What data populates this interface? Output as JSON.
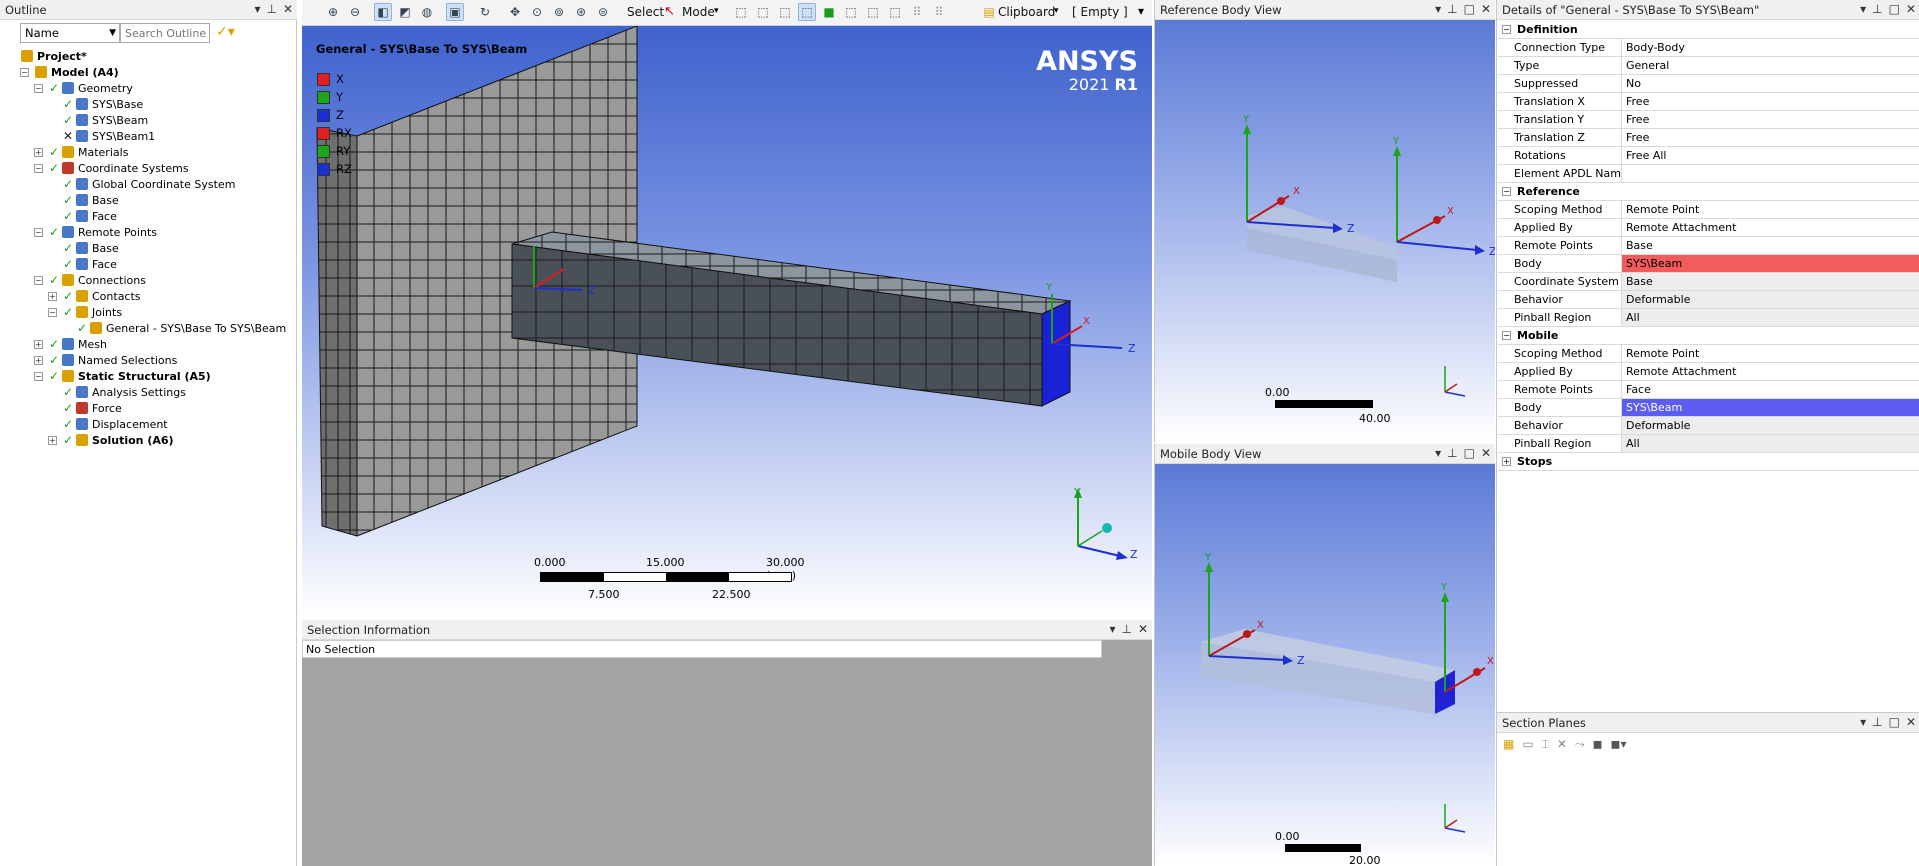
{
  "outline": {
    "title": "Outline",
    "filter_label": "Name",
    "search_placeholder": "Search Outline",
    "items": [
      {
        "label": "Project*",
        "level": 0
      },
      {
        "label": "Model (A4)",
        "level": 1
      },
      {
        "label": "Geometry",
        "level": 2
      },
      {
        "label": "SYS\\Base",
        "level": 3
      },
      {
        "label": "SYS\\Beam",
        "level": 3
      },
      {
        "label": "SYS\\Beam1",
        "level": 3
      },
      {
        "label": "Materials",
        "level": 2
      },
      {
        "label": "Coordinate Systems",
        "level": 2
      },
      {
        "label": "Global Coordinate System",
        "level": 3
      },
      {
        "label": "Base",
        "level": 3
      },
      {
        "label": "Face",
        "level": 3
      },
      {
        "label": "Remote Points",
        "level": 2
      },
      {
        "label": "Base",
        "level": 3
      },
      {
        "label": "Face",
        "level": 3
      },
      {
        "label": "Connections",
        "level": 2
      },
      {
        "label": "Contacts",
        "level": 3
      },
      {
        "label": "Joints",
        "level": 3
      },
      {
        "label": "General - SYS\\Base To SYS\\Beam",
        "level": 4
      },
      {
        "label": "Mesh",
        "level": 2
      },
      {
        "label": "Named Selections",
        "level": 2
      },
      {
        "label": "Static Structural (A5)",
        "level": 2
      },
      {
        "label": "Analysis Settings",
        "level": 3
      },
      {
        "label": "Force",
        "level": 3
      },
      {
        "label": "Displacement",
        "level": 3
      },
      {
        "label": "Solution (A6)",
        "level": 3
      }
    ]
  },
  "toolbar": {
    "select_label": "Select",
    "mode_label": "Mode",
    "clipboard_label": "Clipboard",
    "empty_label": "[ Empty ]"
  },
  "viewport": {
    "title": "General - SYS\\Base To SYS\\Beam",
    "brand": "ANSYS",
    "version_year": "2021",
    "version_rel": "R1",
    "legend": [
      {
        "label": "X",
        "color": "#e02020"
      },
      {
        "label": "Y",
        "color": "#1aa51a"
      },
      {
        "label": "Z",
        "color": "#1c2fd0"
      },
      {
        "label": "RX",
        "color": "#e02020"
      },
      {
        "label": "RY",
        "color": "#1aa51a"
      },
      {
        "label": "RZ",
        "color": "#1c2fd0"
      }
    ],
    "scale_top": [
      "0.000",
      "15.000",
      "30.000 (mm)"
    ],
    "scale_bottom": [
      "7.500",
      "22.500"
    ],
    "axis_y": "Y",
    "axis_z": "Z",
    "axis_x": "X"
  },
  "selection_info": {
    "title": "Selection Information",
    "text": "No Selection"
  },
  "reference_view": {
    "title": "Reference Body View",
    "scale_min": "0.00",
    "scale_max": "40.00"
  },
  "mobile_view": {
    "title": "Mobile Body View",
    "scale_min": "0.00",
    "scale_max": "20.00"
  },
  "details": {
    "title": "Details of \"General - SYS\\Base To SYS\\Beam\"",
    "sections": [
      {
        "name": "Definition",
        "rows": [
          {
            "k": "Connection Type",
            "v": "Body-Body"
          },
          {
            "k": "Type",
            "v": "General"
          },
          {
            "k": "Suppressed",
            "v": "No"
          },
          {
            "k": "Translation X",
            "v": "Free"
          },
          {
            "k": "Translation Y",
            "v": "Free"
          },
          {
            "k": "Translation Z",
            "v": "Free"
          },
          {
            "k": "Rotations",
            "v": "Free All"
          },
          {
            "k": "Element APDL Name",
            "v": ""
          }
        ]
      },
      {
        "name": "Reference",
        "rows": [
          {
            "k": "Scoping Method",
            "v": "Remote Point"
          },
          {
            "k": "Applied By",
            "v": "Remote Attachment"
          },
          {
            "k": "Remote Points",
            "v": "Base"
          },
          {
            "k": "Body",
            "v": "SYS\\Beam"
          },
          {
            "k": "Coordinate System",
            "v": "Base"
          },
          {
            "k": "Behavior",
            "v": "Deformable"
          },
          {
            "k": "Pinball Region",
            "v": "All"
          }
        ]
      },
      {
        "name": "Mobile",
        "rows": [
          {
            "k": "Scoping Method",
            "v": "Remote Point"
          },
          {
            "k": "Applied By",
            "v": "Remote Attachment"
          },
          {
            "k": "Remote Points",
            "v": "Face"
          },
          {
            "k": "Body",
            "v": "SYS\\Beam"
          },
          {
            "k": "Behavior",
            "v": "Deformable"
          },
          {
            "k": "Pinball Region",
            "v": "All"
          }
        ]
      },
      {
        "name": "Stops",
        "rows": []
      }
    ],
    "colors": {
      "reference_body": "#f25c5c",
      "mobile_body": "#5b5cf0"
    }
  },
  "section_planes": {
    "title": "Section Planes"
  }
}
